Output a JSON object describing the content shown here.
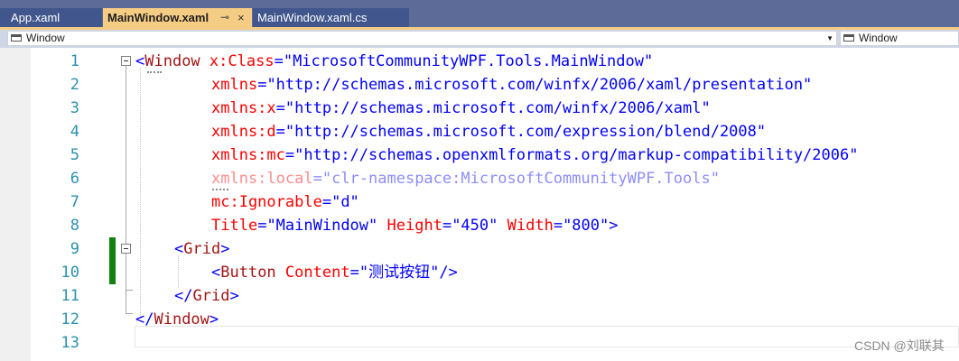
{
  "tabs": [
    {
      "label": "App.xaml",
      "active": false
    },
    {
      "label": "MainWindow.xaml",
      "active": true,
      "pin_icon": "pin-icon",
      "close_icon": "close-icon"
    },
    {
      "label": "MainWindow.xaml.cs",
      "active": false
    }
  ],
  "navbar": {
    "left_scope": "Window",
    "right_scope": "Window"
  },
  "editor": {
    "line_numbers": [
      "1",
      "2",
      "3",
      "4",
      "5",
      "6",
      "7",
      "8",
      "9",
      "10",
      "11",
      "12",
      "13"
    ],
    "lines": {
      "l1": {
        "open": "<",
        "element": "Window",
        "attr": "x:Class",
        "eq": "=",
        "value": "\"MicrosoftCommunityWPF.Tools.MainWindow\""
      },
      "l2": {
        "attr": "xmlns",
        "eq": "=",
        "value": "\"http://schemas.microsoft.com/winfx/2006/xaml/presentation\""
      },
      "l3": {
        "attr": "xmlns:x",
        "eq": "=",
        "value": "\"http://schemas.microsoft.com/winfx/2006/xaml\""
      },
      "l4": {
        "attr": "xmlns:d",
        "eq": "=",
        "value": "\"http://schemas.microsoft.com/expression/blend/2008\""
      },
      "l5": {
        "attr": "xmlns:mc",
        "eq": "=",
        "value": "\"http://schemas.openxmlformats.org/markup-compatibility/2006\""
      },
      "l6": {
        "attr": "xmlns:local",
        "eq": "=",
        "value": "\"clr-namespace:MicrosoftCommunityWPF.Tools\""
      },
      "l7": {
        "attr": "mc:Ignorable",
        "eq": "=",
        "value": "\"d\""
      },
      "l8": {
        "attr1": "Title",
        "eq1": "=",
        "value1": "\"MainWindow\"",
        "attr2": "Height",
        "eq2": "=",
        "value2": "\"450\"",
        "attr3": "Width",
        "eq3": "=",
        "value3": "\"800\"",
        "close": ">"
      },
      "l9": {
        "open": "<",
        "element": "Grid",
        "close": ">"
      },
      "l10": {
        "open": "<",
        "element": "Button",
        "attr": "Content",
        "eq": "=",
        "value": "\"测试按钮\"",
        "close": "/>"
      },
      "l11": {
        "open": "</",
        "element": "Grid",
        "close": ">"
      },
      "l12": {
        "open": "</",
        "element": "Window",
        "close": ">"
      }
    }
  },
  "watermark": "CSDN @刘联其",
  "colors": {
    "tabstrip_bg": "#5d6b99",
    "active_tab": "#f5cc84",
    "line_number": "#2b91af",
    "xml_bracket": "#0000ff",
    "xml_element": "#a31515",
    "xml_attribute": "#ff0000",
    "xml_value": "#0000ff",
    "change_marker": "#108010"
  }
}
